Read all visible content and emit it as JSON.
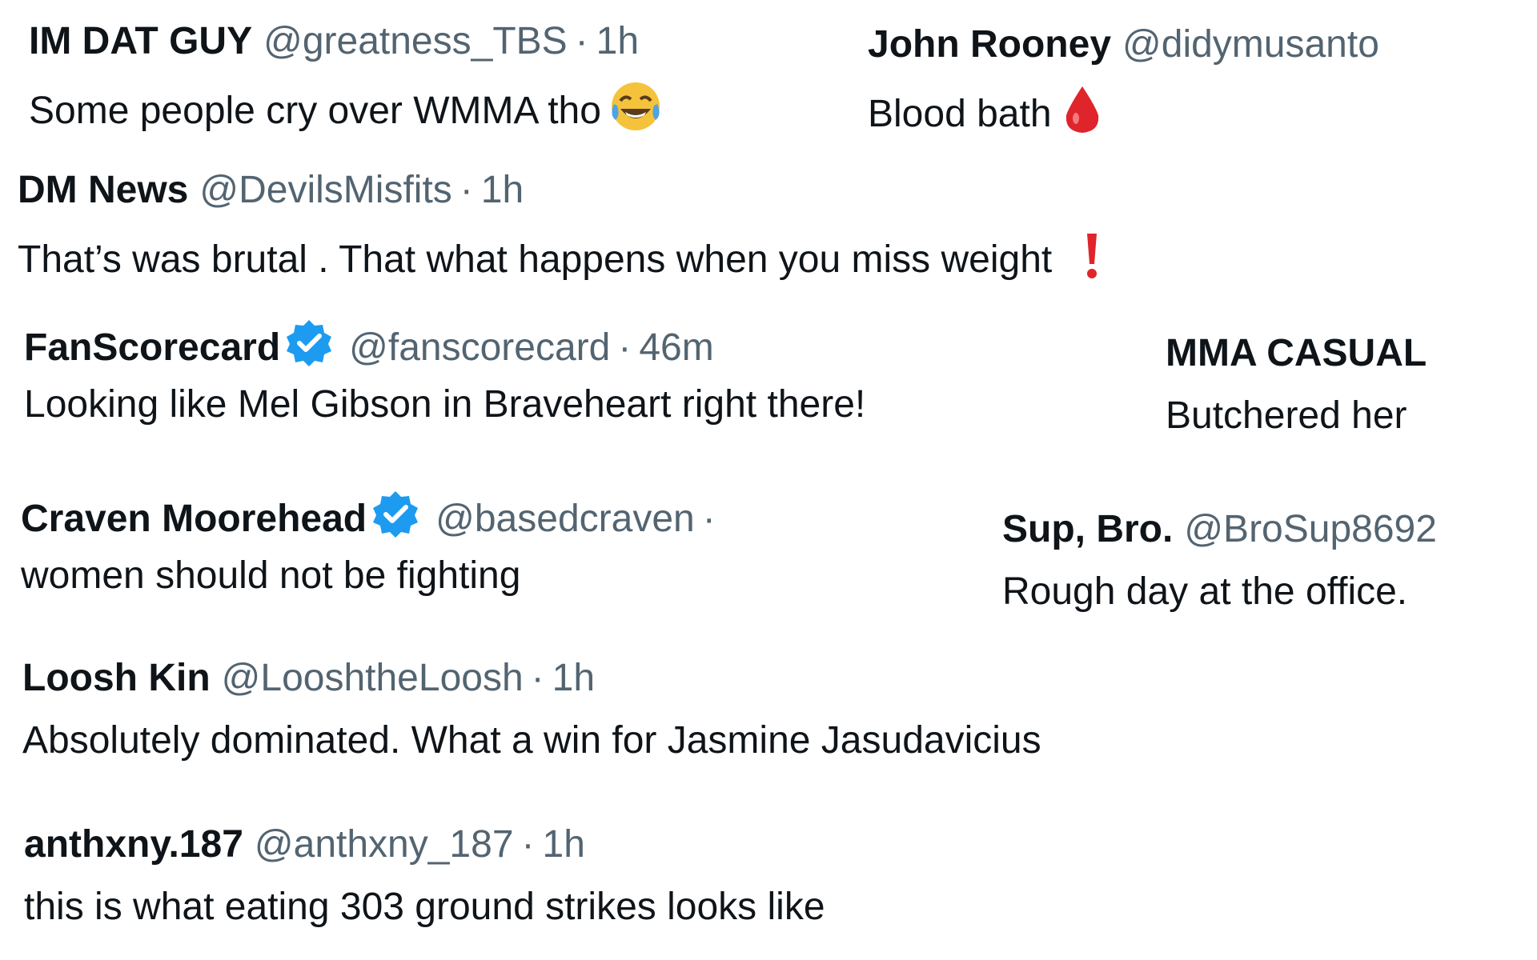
{
  "colors": {
    "name": "#0f1419",
    "muted": "#536471",
    "verified": "#1d9bf0",
    "blood": "#e0242b",
    "exclaim": "#e0242b",
    "emoji_face": "#f5c33b",
    "emoji_tears": "#4da3e6"
  },
  "tweets": [
    {
      "id": "imdatguy",
      "name": "IM DAT GUY",
      "handle": "@greatness_TBS",
      "sep": "·",
      "time": "1h",
      "text": "Some people cry over WMMA tho",
      "emoji": "joy-tears-icon"
    },
    {
      "id": "johnrooney",
      "name": "John Rooney",
      "handle": "@didymusanto",
      "text": "Blood bath",
      "emoji": "drop-of-blood-icon"
    },
    {
      "id": "dmnews",
      "name": "DM News",
      "handle": "@DevilsMisfits",
      "sep": "·",
      "time": "1h",
      "text": "That’s was brutal . That what happens when you miss weight",
      "emoji": "exclamation-icon"
    },
    {
      "id": "fanscorecard",
      "name": "FanScorecard",
      "verified": true,
      "handle": "@fanscorecard",
      "sep": "·",
      "time": "46m",
      "text": "Looking like Mel Gibson in Braveheart right there!"
    },
    {
      "id": "mmacasual",
      "name": "MMA CASUAL",
      "text": "Butchered her"
    },
    {
      "id": "craven",
      "name": "Craven Moorehead",
      "verified": true,
      "handle": "@basedcraven",
      "sep": "·",
      "text": "women should not be fighting"
    },
    {
      "id": "supbro",
      "name": "Sup, Bro.",
      "handle": "@BroSup8692",
      "text": "Rough day at the office."
    },
    {
      "id": "looshkin",
      "name": "Loosh Kin",
      "handle": "@LooshtheLoosh",
      "sep": "·",
      "time": "1h",
      "text": "Absolutely dominated. What a win for Jasmine Jasudavicius"
    },
    {
      "id": "anthxny",
      "name": "anthxny.187",
      "handle": "@anthxny_187",
      "sep": "·",
      "time": "1h",
      "text": "this is what eating 303 ground strikes looks like"
    }
  ]
}
